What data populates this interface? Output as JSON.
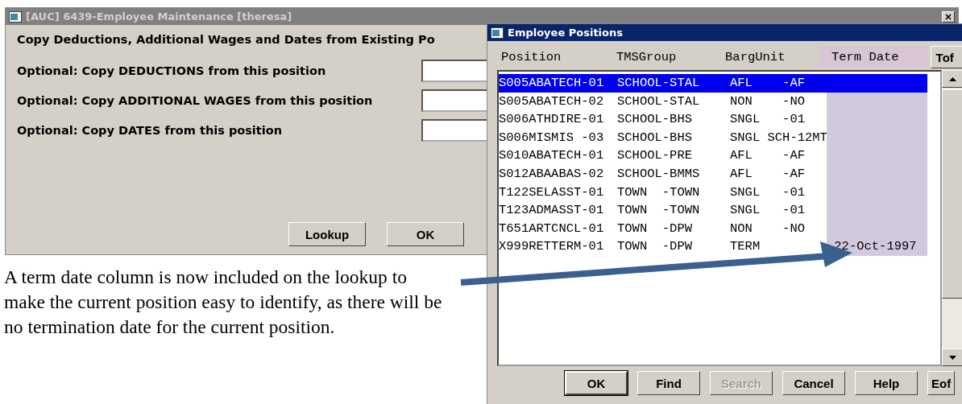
{
  "main_window": {
    "title": "[AUC] 6439-Employee Maintenance [theresa]",
    "active": false,
    "heading": "Copy Deductions, Additional Wages and Dates from Existing Po",
    "fields": [
      {
        "label": "Optional: Copy DEDUCTIONS from this position"
      },
      {
        "label": "Optional: Copy ADDITIONAL WAGES from this position"
      },
      {
        "label": "Optional: Copy DATES from this position"
      }
    ],
    "buttons": [
      {
        "label": "Lookup"
      },
      {
        "label": "OK"
      }
    ]
  },
  "popup": {
    "title": "Employee Positions",
    "active": true,
    "columns": [
      {
        "label": "Position",
        "highlighted": false
      },
      {
        "label": "TMSGroup",
        "highlighted": false
      },
      {
        "label": "BargUnit",
        "highlighted": false
      },
      {
        "label": "Term Date",
        "highlighted": true
      }
    ],
    "side_button": "Tof",
    "rows": [
      {
        "position": "S005ABATECH-01",
        "tms_group": "SCHOOL-STAL",
        "barg_unit": "AFL    -AF",
        "selected": true
      },
      {
        "position": "S005ABATECH-02",
        "tms_group": "SCHOOL-STAL",
        "barg_unit": "NON    -NO",
        "selected": false
      },
      {
        "position": "S006ATHDIRE-01",
        "tms_group": "SCHOOL-BHS",
        "barg_unit": "SNGL   -01",
        "selected": false
      },
      {
        "position": "S006MISMIS -03",
        "tms_group": "SCHOOL-BHS",
        "barg_unit": "SNGL SCH-12MT",
        "selected": false
      },
      {
        "position": "S010ABATECH-01",
        "tms_group": "SCHOOL-PRE",
        "barg_unit": "AFL    -AF",
        "selected": false
      },
      {
        "position": "S012ABAABAS-02",
        "tms_group": "SCHOOL-BMMS",
        "barg_unit": "AFL    -AF",
        "selected": false
      },
      {
        "position": "T122SELASST-01",
        "tms_group": "TOWN  -TOWN",
        "barg_unit": "SNGL   -01",
        "selected": false
      },
      {
        "position": "T123ADMASST-01",
        "tms_group": "TOWN  -TOWN",
        "barg_unit": "SNGL   -01",
        "selected": false
      },
      {
        "position": "T651ARTCNCL-01",
        "tms_group": "TOWN  -DPW",
        "barg_unit": "NON    -NO",
        "selected": false
      },
      {
        "position": "X999RETTERM-01",
        "tms_group": "TOWN  -DPW",
        "barg_unit": "TERM",
        "term_date": "22-Oct-1997",
        "selected": false
      }
    ],
    "buttons": [
      {
        "label": "OK",
        "disabled": false,
        "default": true
      },
      {
        "label": "Find",
        "disabled": false,
        "default": false
      },
      {
        "label": "Search",
        "disabled": true,
        "default": false
      },
      {
        "label": "Cancel",
        "disabled": false,
        "default": false
      },
      {
        "label": "Help",
        "disabled": false,
        "default": false
      },
      {
        "label": "Eof",
        "disabled": false,
        "default": false
      }
    ]
  },
  "annotation": {
    "text": "A term date column is now included on the lookup to make the current position easy to identify, as there will be no termination date for the current position."
  }
}
